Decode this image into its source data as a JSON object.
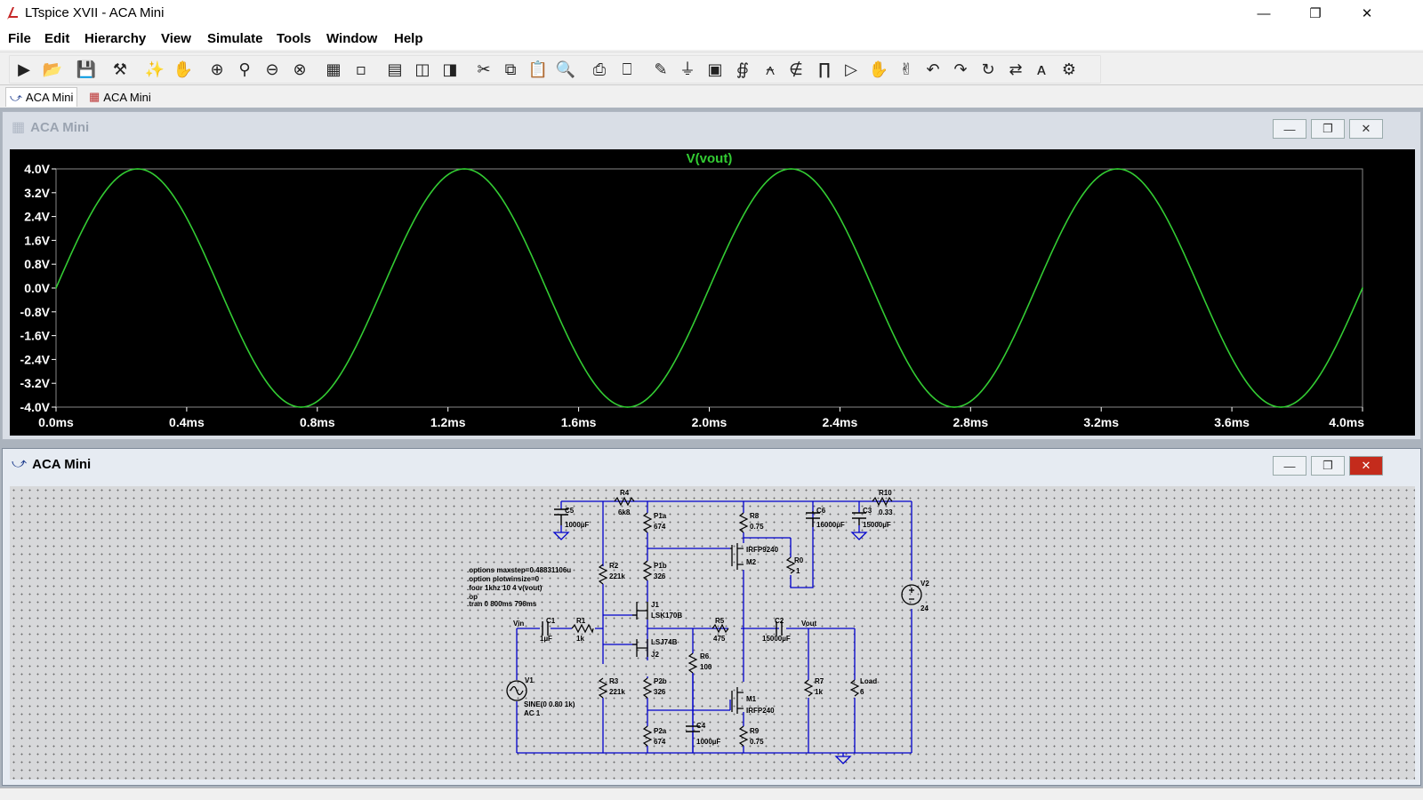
{
  "window": {
    "title": "LTspice XVII - ACA Mini",
    "controls": [
      "minimize",
      "maximize",
      "close"
    ]
  },
  "menu": [
    "File",
    "Edit",
    "Hierarchy",
    "View",
    "Simulate",
    "Tools",
    "Window",
    "Help"
  ],
  "tabs": [
    {
      "label": "ACA Mini",
      "icon": "schematic-icon"
    },
    {
      "label": "ACA Mini",
      "icon": "waveform-icon"
    }
  ],
  "plot_window": {
    "title": "ACA Mini",
    "trace_label": "V(vout)",
    "trace_color": "#33cc33",
    "grid_color": "#888888",
    "axis_color": "#ffffff"
  },
  "schematic_window": {
    "title": "ACA Mini",
    "directives": [
      ".options maxstep=0.48831106u",
      ".option plotwinsize=0",
      ".four 1khz 10 4 v(vout)",
      ".op",
      ".tran 0 800ms 796ms"
    ],
    "labels": [
      {
        "id": "R4",
        "name": "R4",
        "value": "6k8"
      },
      {
        "id": "R10",
        "name": "R10",
        "value": "0.33"
      },
      {
        "id": "C5",
        "name": "C5",
        "value": "1000µF"
      },
      {
        "id": "P1a",
        "name": "P1a",
        "value": "674"
      },
      {
        "id": "R8",
        "name": "R8",
        "value": "0.75"
      },
      {
        "id": "C6",
        "name": "C6",
        "value": "16000µF"
      },
      {
        "id": "C3",
        "name": "C3",
        "value": "15000µF"
      },
      {
        "id": "M2",
        "name": "M2",
        "value": "IRFP9240"
      },
      {
        "id": "R0",
        "name": "R0",
        "value": "1"
      },
      {
        "id": "R2",
        "name": "R2",
        "value": "221k"
      },
      {
        "id": "P1b",
        "name": "P1b",
        "value": "326"
      },
      {
        "id": "V2",
        "name": "V2",
        "value": "24"
      },
      {
        "id": "J1",
        "name": "J1",
        "value": "LSK170B"
      },
      {
        "id": "C1",
        "name": "C1",
        "value": "1µF"
      },
      {
        "id": "R1",
        "name": "R1",
        "value": "1k"
      },
      {
        "id": "R5",
        "name": "R5",
        "value": "475"
      },
      {
        "id": "C2",
        "name": "C2",
        "value": "15000µF"
      },
      {
        "id": "J2",
        "name": "J2",
        "value": "LSJ74B"
      },
      {
        "id": "R6",
        "name": "R6",
        "value": "100"
      },
      {
        "id": "V1",
        "name": "V1",
        "value": "SINE(0 0.80 1k)"
      },
      {
        "id": "R3",
        "name": "R3",
        "value": "221k"
      },
      {
        "id": "P2b",
        "name": "P2b",
        "value": "326"
      },
      {
        "id": "R7",
        "name": "R7",
        "value": "1k"
      },
      {
        "id": "Load",
        "name": "Load",
        "value": "6"
      },
      {
        "id": "M1",
        "name": "M1",
        "value": "IRFP240"
      },
      {
        "id": "C4",
        "name": "C4",
        "value": "1000µF"
      },
      {
        "id": "P2a",
        "name": "P2a",
        "value": "674"
      },
      {
        "id": "R9",
        "name": "R9",
        "value": "0.75"
      }
    ],
    "v1_ac": "AC 1",
    "net_vin": "Vin",
    "net_vout": "Vout"
  },
  "chart_data": {
    "type": "line",
    "title": "V(vout)",
    "xlabel": "",
    "ylabel": "",
    "x_ticks": [
      "0.0ms",
      "0.4ms",
      "0.8ms",
      "1.2ms",
      "1.6ms",
      "2.0ms",
      "2.4ms",
      "2.8ms",
      "3.2ms",
      "3.6ms",
      "4.0ms"
    ],
    "y_ticks": [
      "4.0V",
      "3.2V",
      "2.4V",
      "1.6V",
      "0.8V",
      "0.0V",
      "-0.8V",
      "-1.6V",
      "-2.4V",
      "-3.2V",
      "-4.0V"
    ],
    "xlim": [
      0,
      4.0
    ],
    "ylim": [
      -4.0,
      4.0
    ],
    "x_unit": "ms",
    "y_unit": "V",
    "grid": false,
    "series": [
      {
        "name": "V(vout)",
        "signal": "sine",
        "frequency_khz": 1.0,
        "amplitude_v": 4.0,
        "phase_deg": 0,
        "x": [
          0.0,
          0.25,
          0.5,
          0.75,
          1.0,
          1.25,
          1.5,
          1.75,
          2.0,
          2.25,
          2.5,
          2.75,
          3.0,
          3.25,
          3.5,
          3.75,
          4.0
        ],
        "y": [
          0.0,
          4.0,
          0.0,
          -4.0,
          0.0,
          4.0,
          0.0,
          -4.0,
          0.0,
          4.0,
          0.0,
          -4.0,
          0.0,
          4.0,
          0.0,
          -4.0,
          0.0
        ]
      }
    ]
  }
}
